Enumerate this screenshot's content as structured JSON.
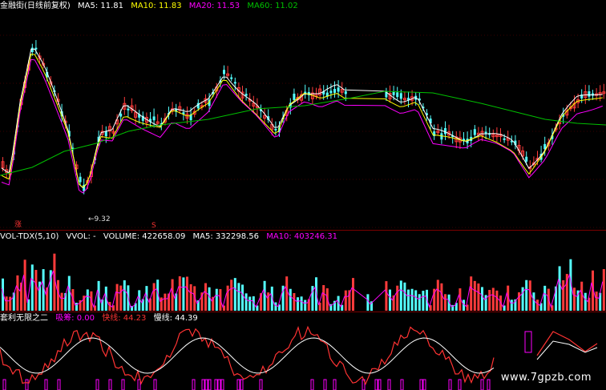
{
  "main": {
    "title": "金融街(日线前复权)",
    "ma5": "MA5: 11.81",
    "ma10": "MA10: 11.83",
    "ma20": "MA20: 11.53",
    "ma60": "MA60: 11.02",
    "low_label": "←9.32",
    "marker_zhang": "涨",
    "marker_s": "S"
  },
  "volume": {
    "title": "VOL-TDX(5,10)",
    "vvol": "VVOL: -",
    "vol": "VOLUME: 422658.09",
    "ma5": "MA5: 332298.56",
    "ma10": "MA10: 403246.31"
  },
  "indicator": {
    "title": "套利无限之二",
    "a": "吸筹: 0.00",
    "b": "快线: 44.23",
    "c": "慢线: 44.39"
  },
  "watermark": "www.7gpzb.com",
  "colors": {
    "up": "#ff3b3b",
    "down": "#54ffff",
    "ma5": "#ffffff",
    "ma10": "#ffff00",
    "ma20": "#ff00ff",
    "ma60": "#00c000",
    "grid": "#7a0000"
  }
}
